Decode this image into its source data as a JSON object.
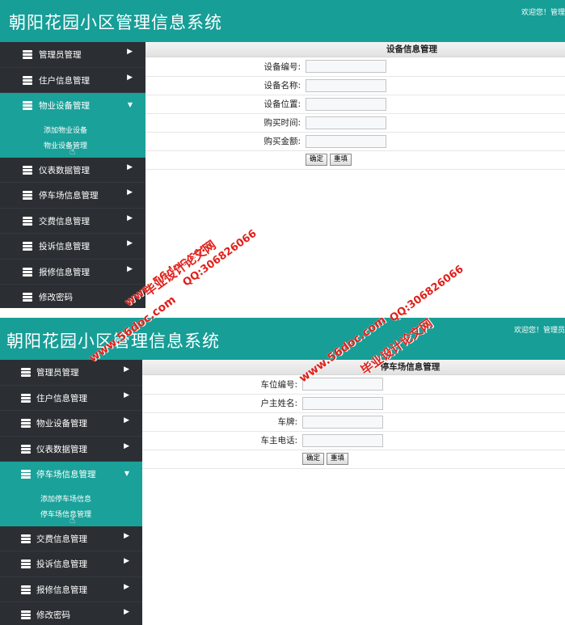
{
  "app_title": "朝阳花园小区管理信息系统",
  "welcome_text_1": "欢迎您！管理",
  "welcome_text_2": "欢迎您！管理员",
  "menu": [
    "管理员管理",
    "住户信息管理",
    "物业设备管理",
    "仪表数据管理",
    "停车场信息管理",
    "交费信息管理",
    "投诉信息管理",
    "报修信息管理",
    "修改密码"
  ],
  "screen1": {
    "submenu": [
      "添加物业设备",
      "物业设备管理"
    ],
    "form_title": "设备信息管理",
    "fields": [
      "设备编号:",
      "设备名称:",
      "设备位置:",
      "购买时间:",
      "购买金额:"
    ],
    "confirm": "确定",
    "reset": "重填"
  },
  "screen2": {
    "submenu": [
      "添加停车场信息",
      "停车场信息管理"
    ],
    "form_title": "停车场信息管理",
    "fields": [
      "车位编号:",
      "户主姓名:",
      "车牌:",
      "车主电话:"
    ],
    "confirm": "确定",
    "reset": "重填"
  },
  "watermark": {
    "site": "www.56doc.com",
    "name": "毕业设计论文网",
    "qq": "QQ:306826066"
  },
  "colors": {
    "header": "#169e97",
    "sidebar": "#2b2f33",
    "active": "#1aa19a",
    "watermark": "#e0211b"
  }
}
